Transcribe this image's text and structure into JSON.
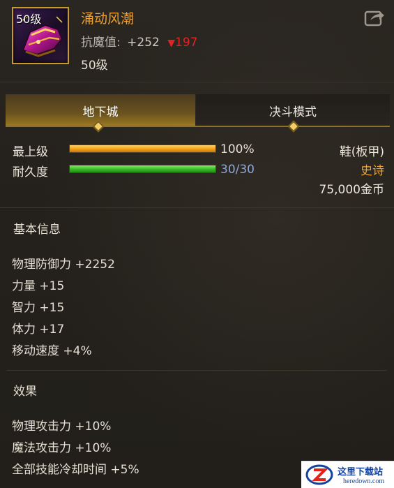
{
  "item": {
    "level_badge": "50级",
    "name": "涌动风潮",
    "resist_label": "抗魔值:",
    "resist_value": "+252",
    "resist_down_value": "197",
    "level_text": "50级",
    "icon": "purple-boots-icon"
  },
  "share_icon": "share-icon",
  "tabs": [
    {
      "label": "地下城",
      "active": true
    },
    {
      "label": "决斗模式",
      "active": false
    }
  ],
  "bars": {
    "upgrade": {
      "label": "最上级",
      "value_text": "100%",
      "fill": 1.0
    },
    "durability": {
      "label": "耐久度",
      "value_text": "30/30",
      "fill": 1.0
    }
  },
  "item_type": "鞋(板甲)",
  "rarity": "史诗",
  "price": "75,000金币",
  "basic_info": {
    "title": "基本信息",
    "stats": [
      "物理防御力 +2252",
      "力量 +15",
      "智力 +15",
      "体力 +17",
      "移动速度 +4%"
    ]
  },
  "effects": {
    "title": "效果",
    "stats": [
      "物理攻击力 +10%",
      "魔法攻击力 +10%",
      "全部技能冷却时间 +5%"
    ]
  },
  "watermark": {
    "text_main": "这里下载站",
    "text_sub": "heredown.com"
  },
  "colors": {
    "item_name": "#f4a12b",
    "rarity": "#f4a12b",
    "down_arrow": "#e02323",
    "durability_value": "#8fa8d6"
  }
}
